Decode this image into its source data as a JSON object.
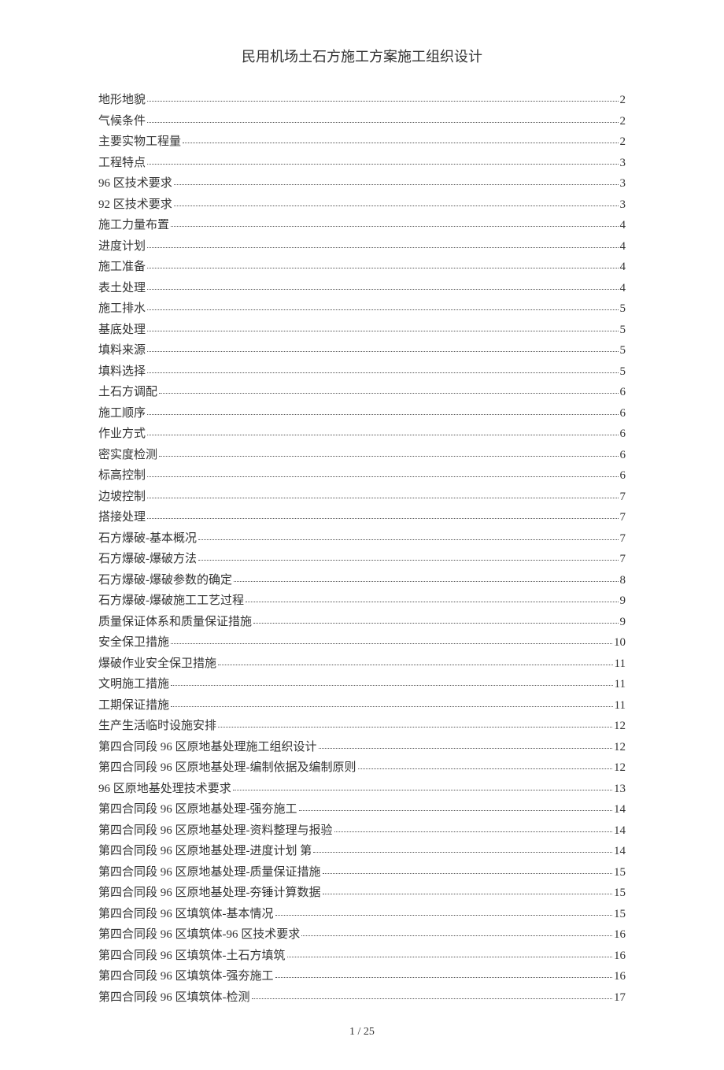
{
  "title": "民用机场土石方施工方案施工组织设计",
  "footer": "1 / 25",
  "toc": [
    {
      "label": "地形地貌",
      "page": "2"
    },
    {
      "label": "气候条件",
      "page": "2"
    },
    {
      "label": "主要实物工程量",
      "page": "2"
    },
    {
      "label": "工程特点",
      "page": "3"
    },
    {
      "label": "96 区技术要求",
      "page": "3"
    },
    {
      "label": "92 区技术要求",
      "page": "3"
    },
    {
      "label": "施工力量布置",
      "page": "4"
    },
    {
      "label": "进度计划",
      "page": "4"
    },
    {
      "label": "施工准备",
      "page": "4"
    },
    {
      "label": "表土处理",
      "page": "4"
    },
    {
      "label": "施工排水",
      "page": "5"
    },
    {
      "label": "基底处理",
      "page": "5"
    },
    {
      "label": "填料来源",
      "page": "5"
    },
    {
      "label": "填料选择",
      "page": "5"
    },
    {
      "label": "土石方调配",
      "page": "6"
    },
    {
      "label": "施工顺序",
      "page": "6"
    },
    {
      "label": "作业方式",
      "page": "6"
    },
    {
      "label": "密实度检测",
      "page": "6"
    },
    {
      "label": "标高控制",
      "page": "6"
    },
    {
      "label": "边坡控制",
      "page": "7"
    },
    {
      "label": "搭接处理",
      "page": "7"
    },
    {
      "label": "石方爆破-基本概况",
      "page": "7"
    },
    {
      "label": "石方爆破-爆破方法",
      "page": "7"
    },
    {
      "label": "石方爆破-爆破参数的确定",
      "page": "8"
    },
    {
      "label": "石方爆破-爆破施工工艺过程",
      "page": "9"
    },
    {
      "label": "质量保证体系和质量保证措施",
      "page": "9"
    },
    {
      "label": "安全保卫措施",
      "page": "10"
    },
    {
      "label": "爆破作业安全保卫措施",
      "page": "11"
    },
    {
      "label": "文明施工措施",
      "page": "11"
    },
    {
      "label": "工期保证措施",
      "page": "11"
    },
    {
      "label": "生产生活临时设施安排",
      "page": "12"
    },
    {
      "label": "第四合同段 96 区原地基处理施工组织设计",
      "page": "12"
    },
    {
      "label": "第四合同段 96 区原地基处理-编制依据及编制原则",
      "page": "12"
    },
    {
      "label": "96 区原地基处理技术要求",
      "page": "13"
    },
    {
      "label": "第四合同段 96 区原地基处理-强夯施工",
      "page": "14"
    },
    {
      "label": "第四合同段 96 区原地基处理-资料整理与报验",
      "page": "14"
    },
    {
      "label": "第四合同段 96 区原地基处理-进度计划   第",
      "page": "14"
    },
    {
      "label": "第四合同段 96 区原地基处理-质量保证措施",
      "page": "15"
    },
    {
      "label": "第四合同段 96 区原地基处理-夯锤计算数据",
      "page": "15"
    },
    {
      "label": "第四合同段 96 区填筑体-基本情况",
      "page": "15"
    },
    {
      "label": "第四合同段 96 区填筑体-96 区技术要求",
      "page": "16"
    },
    {
      "label": "第四合同段 96 区填筑体-土石方填筑",
      "page": "16"
    },
    {
      "label": "第四合同段 96 区填筑体-强夯施工",
      "page": "16"
    },
    {
      "label": "第四合同段 96 区填筑体-检测",
      "page": "17"
    }
  ]
}
